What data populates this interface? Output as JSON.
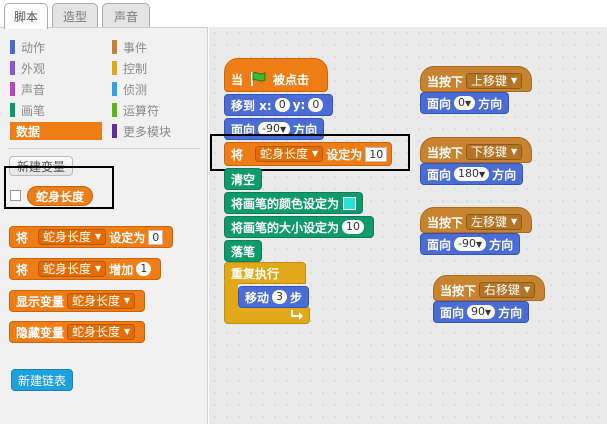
{
  "tabs": [
    {
      "label": "脚本",
      "active": true
    },
    {
      "label": "造型",
      "active": false
    },
    {
      "label": "声音",
      "active": false
    }
  ],
  "categories": [
    {
      "label": "动作",
      "color": "#4a6cd4"
    },
    {
      "label": "事件",
      "color": "#c88330"
    },
    {
      "label": "外观",
      "color": "#8a55d7"
    },
    {
      "label": "控制",
      "color": "#e1a91a"
    },
    {
      "label": "声音",
      "color": "#bb42c3"
    },
    {
      "label": "侦测",
      "color": "#2ca5e2"
    },
    {
      "label": "画笔",
      "color": "#0e9a6c"
    },
    {
      "label": "运算符",
      "color": "#5cb712"
    },
    {
      "label": "数据",
      "color": "#ee7d16",
      "selected": true
    },
    {
      "label": "更多模块",
      "color": "#632d99"
    }
  ],
  "palette": {
    "new_variable": "新建变量",
    "variable_name": "蛇身长度",
    "set_block": {
      "kw": "将",
      "var": "蛇身长度",
      "mid": "设定为",
      "value": "0"
    },
    "change_block": {
      "kw": "将",
      "var": "蛇身长度",
      "mid": "增加",
      "value": "1"
    },
    "show_block": {
      "kw": "显示变量",
      "var": "蛇身长度"
    },
    "hide_block": {
      "kw": "隐藏变量",
      "var": "蛇身长度"
    },
    "new_list": "新建链表"
  },
  "script_main": {
    "hat_when": "当",
    "hat_clicked": "被点击",
    "goto": {
      "kw": "移到 x:",
      "x": "0",
      "ylabel": "y:",
      "y": "0"
    },
    "point": {
      "kw": "面向",
      "value": "-90",
      "suffix": "方向"
    },
    "set_var": {
      "kw": "将",
      "var": "蛇身长度",
      "mid": "设定为",
      "value": "10"
    },
    "clear": "清空",
    "set_color": "将画笔的颜色设定为",
    "set_size": {
      "kw": "将画笔的大小设定为",
      "value": "10"
    },
    "pen_down": "落笔",
    "forever": "重复执行",
    "move": {
      "kw": "移动",
      "value": "3",
      "suffix": "步"
    }
  },
  "key_scripts": [
    {
      "when": "当按下",
      "key": "上移键",
      "face": "面向",
      "dir": "0",
      "suffix": "方向"
    },
    {
      "when": "当按下",
      "key": "下移键",
      "face": "面向",
      "dir": "180",
      "suffix": "方向"
    },
    {
      "when": "当按下",
      "key": "左移键",
      "face": "面向",
      "dir": "-90",
      "suffix": "方向"
    },
    {
      "when": "当按下",
      "key": "右移键",
      "face": "面向",
      "dir": "90",
      "suffix": "方向"
    }
  ],
  "colors": {
    "data_orange": "#ee7d16",
    "motion_blue": "#4a6cd4",
    "pen_green": "#0e9a6c",
    "control_yellow": "#e1a91a",
    "event_brown": "#c88330"
  }
}
